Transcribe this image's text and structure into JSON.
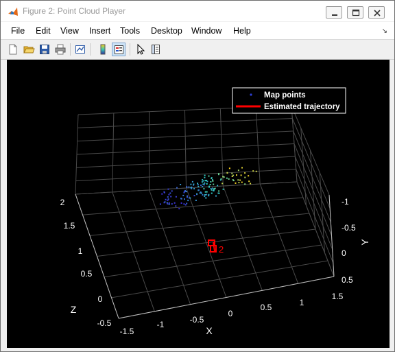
{
  "window": {
    "title": "Figure 2: Point Cloud Player",
    "controls": [
      "minimize",
      "maximize",
      "close"
    ]
  },
  "menubar": {
    "items": [
      "File",
      "Edit",
      "View",
      "Insert",
      "Tools",
      "Desktop",
      "Window",
      "Help"
    ]
  },
  "toolbar": {
    "buttons": [
      "new-figure-icon",
      "open-file-icon",
      "save-icon",
      "print-icon",
      "link-plot-icon",
      "insert-colorbar-icon",
      "insert-legend-icon",
      "edit-plot-icon",
      "property-inspector-icon"
    ]
  },
  "plot": {
    "background": "#000000",
    "legend": {
      "entries": [
        "Map points",
        "Estimated trajectory"
      ],
      "placement": "top-right"
    },
    "axes": {
      "x": {
        "label": "X",
        "ticks": [
          "-1.5",
          "-1",
          "-0.5",
          "0",
          "0.5",
          "1",
          "1.5"
        ]
      },
      "y": {
        "label": "Y",
        "ticks": [
          "-1",
          "-0.5",
          "0",
          "0.5"
        ]
      },
      "z": {
        "label": "Z",
        "ticks": [
          "2",
          "1.5",
          "1",
          "0.5",
          "0",
          "-0.5"
        ]
      }
    },
    "camera_annotation": "2",
    "colors": {
      "trajectory": "#ff0000",
      "points_low": "#3b2fd6",
      "points_high": "#ffd21a"
    }
  }
}
